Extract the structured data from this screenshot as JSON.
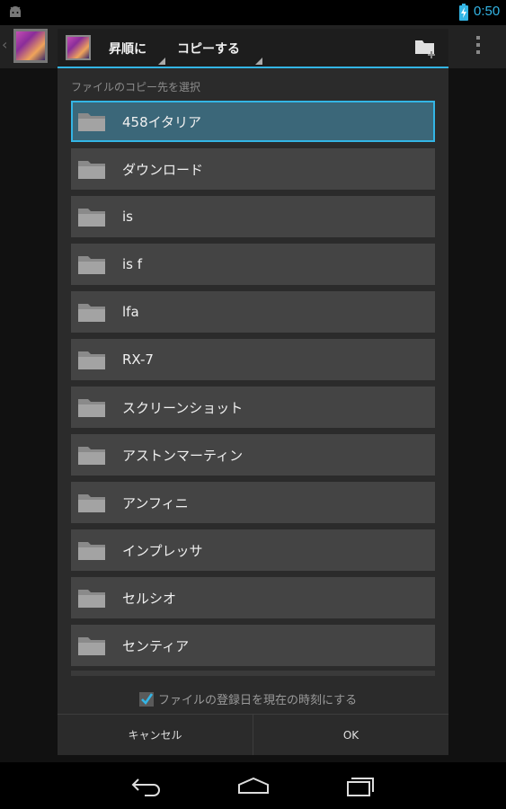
{
  "status_bar": {
    "time": "0:50",
    "accent_color": "#33b5e5"
  },
  "dialog": {
    "sort_label": "昇順に",
    "operation_label": "コピーする",
    "subtitle": "ファイルのコピー先を選択",
    "folders": [
      "458イタリア",
      "ダウンロード",
      "is",
      "is f",
      "lfa",
      "RX-7",
      "スクリーンショット",
      "アストンマーティン",
      "アンフィニ",
      "インプレッサ",
      "セルシオ",
      "センティア"
    ],
    "selected_index": 0,
    "checkbox": {
      "label": "ファイルの登録日を現在の時刻にする",
      "checked": true
    },
    "cancel_label": "キャンセル",
    "ok_label": "OK"
  },
  "icons": {
    "status_left": "android-icon",
    "battery": "battery-charging-icon",
    "new_folder": "new-folder-icon",
    "folder": "folder-icon",
    "nav_back": "back-icon",
    "nav_home": "home-icon",
    "nav_recent": "recent-apps-icon"
  }
}
